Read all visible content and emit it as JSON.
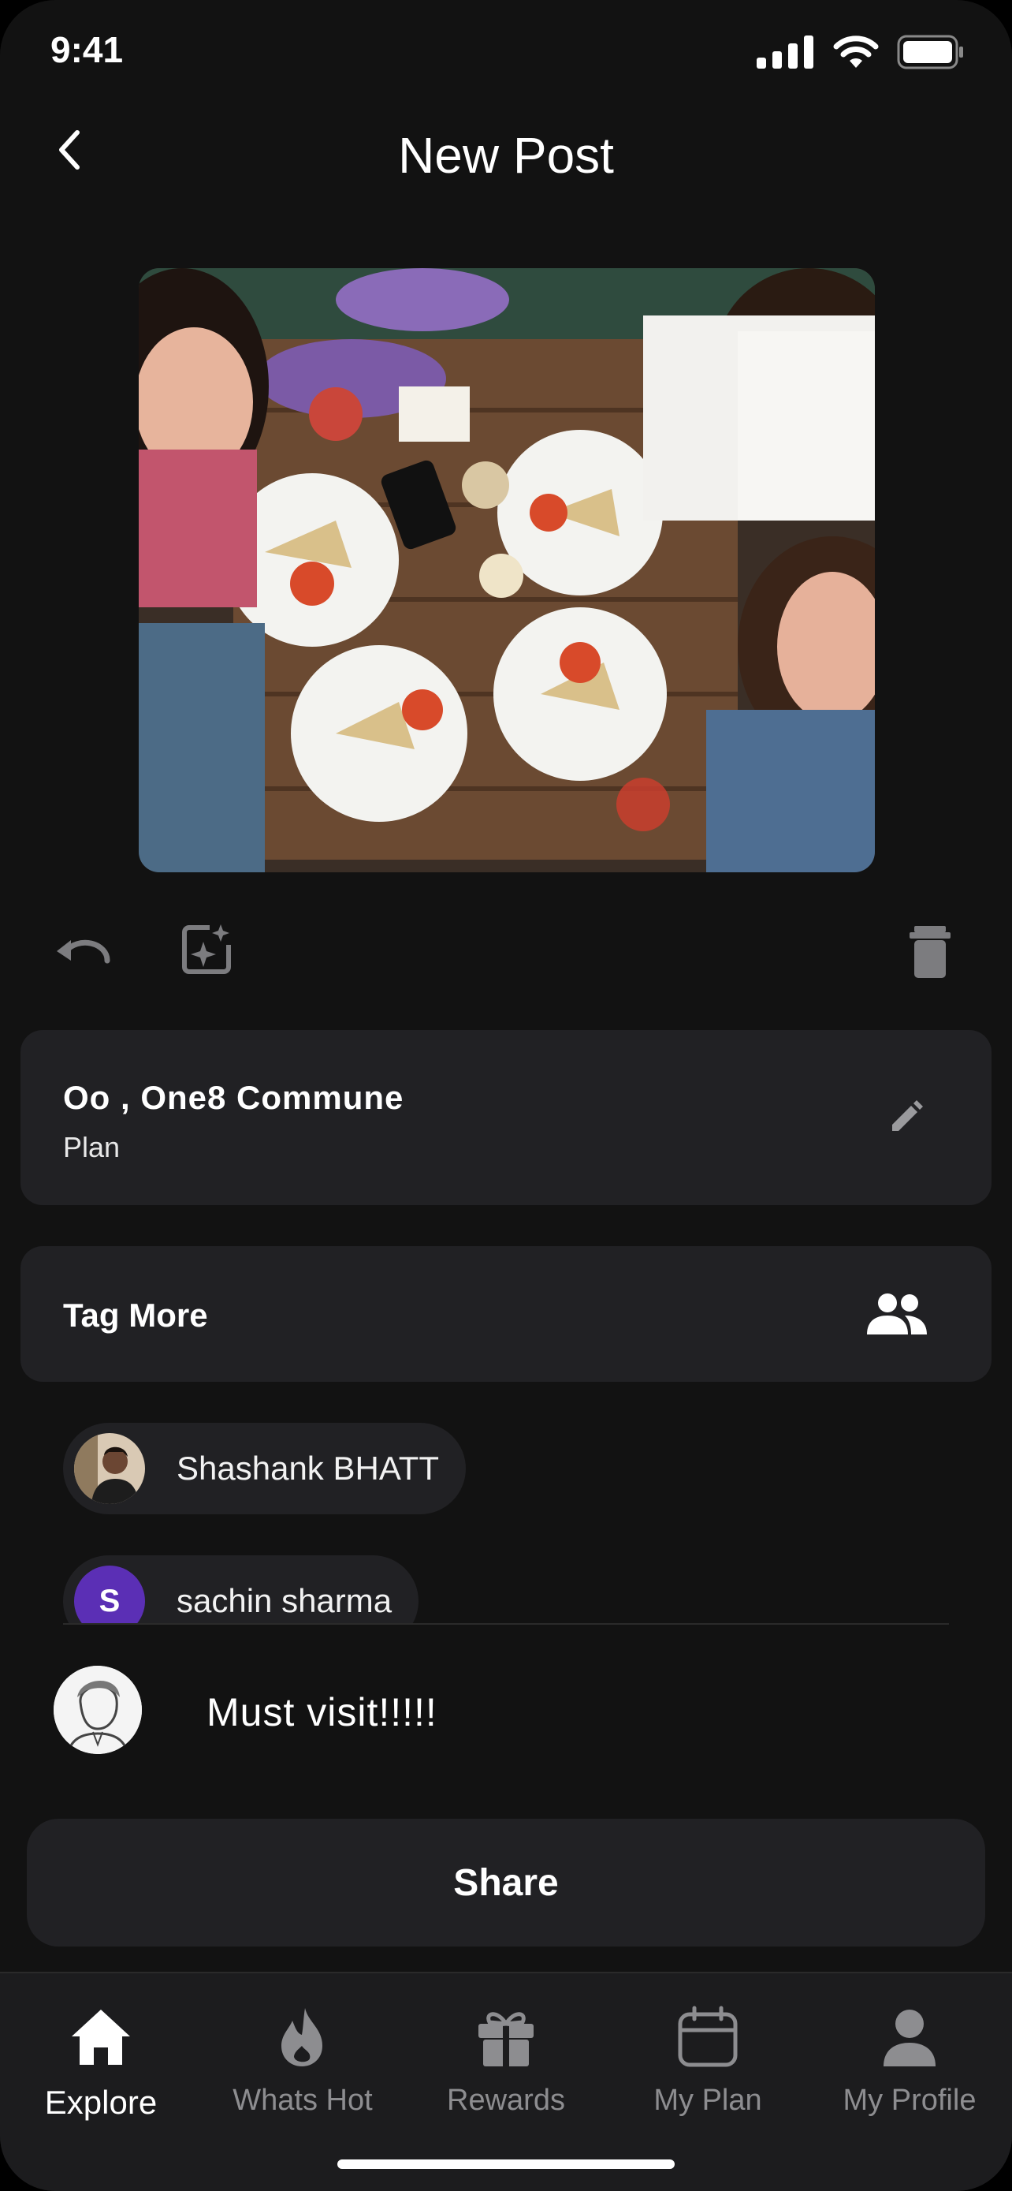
{
  "status_bar": {
    "time": "9:41"
  },
  "header": {
    "title": "New Post",
    "back_icon": "chevron-left-icon"
  },
  "toolbar": {
    "undo_icon": "undo-icon",
    "enhance_icon": "sparkle-frame-icon",
    "delete_icon": "trash-icon"
  },
  "place": {
    "name": "Oo , One8 Commune",
    "subtitle": "Plan",
    "edit_icon": "pencil-icon"
  },
  "tag": {
    "label": "Tag More",
    "icon": "people-icon"
  },
  "tagged_users": [
    {
      "name": "Shashank BHATT",
      "avatar": "photo"
    },
    {
      "name": "sachin sharma",
      "avatar_letter": "S",
      "avatar_color": "#5b2fb5"
    }
  ],
  "comment": {
    "text": "Must visit!!!!!"
  },
  "share": {
    "label": "Share"
  },
  "nav": {
    "items": [
      {
        "label": "Explore",
        "icon": "home-icon",
        "active": true
      },
      {
        "label": "Whats Hot",
        "icon": "flame-icon",
        "active": false
      },
      {
        "label": "Rewards",
        "icon": "gift-icon",
        "active": false
      },
      {
        "label": "My Plan",
        "icon": "calendar-icon",
        "active": false
      },
      {
        "label": "My Profile",
        "icon": "person-icon",
        "active": false
      }
    ]
  },
  "colors": {
    "background": "#121212",
    "card": "#212124",
    "nav_background": "#1c1c1e",
    "inactive": "#8d8d90"
  }
}
